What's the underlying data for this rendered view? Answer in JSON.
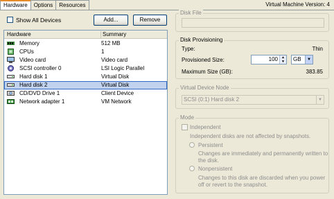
{
  "tabs": [
    {
      "label": "Hardware",
      "active": true
    },
    {
      "label": "Options",
      "active": false
    },
    {
      "label": "Resources",
      "active": false
    }
  ],
  "version": "Virtual Machine Version: 4",
  "show_all": {
    "label": "Show All Devices",
    "checked": false
  },
  "buttons": {
    "add": "Add...",
    "remove": "Remove"
  },
  "list": {
    "headers": {
      "hardware": "Hardware",
      "summary": "Summary"
    },
    "rows": [
      {
        "name": "Memory",
        "summary": "512 MB",
        "icon": "memory-icon"
      },
      {
        "name": "CPUs",
        "summary": "1",
        "icon": "cpu-icon"
      },
      {
        "name": "Video card",
        "summary": "Video card",
        "icon": "video-card-icon"
      },
      {
        "name": "SCSI controller 0",
        "summary": "LSI Logic Parallel",
        "icon": "scsi-controller-icon"
      },
      {
        "name": "Hard disk 1",
        "summary": "Virtual Disk",
        "icon": "hard-disk-icon"
      },
      {
        "name": "Hard disk 2",
        "summary": "Virtual Disk",
        "icon": "hard-disk-icon"
      },
      {
        "name": "CD/DVD Drive 1",
        "summary": "Client Device",
        "icon": "cd-dvd-icon"
      },
      {
        "name": "Network adapter 1",
        "summary": "VM Network",
        "icon": "network-adapter-icon"
      }
    ],
    "selected_index": 5
  },
  "disk_file": {
    "title": "Disk File",
    "value": ""
  },
  "provisioning": {
    "title": "Disk Provisioning",
    "type_label": "Type:",
    "type_value": "Thin",
    "size_label": "Provisioned Size:",
    "size_value": "100",
    "size_unit": "GB",
    "max_label": "Maximum Size (GB):",
    "max_value": "383.85"
  },
  "device_node": {
    "title": "Virtual Device Node",
    "value": "SCSI (0:1) Hard disk 2"
  },
  "mode": {
    "title": "Mode",
    "independent_label": "Independent",
    "independent_desc": "Independent disks are not affected by snapshots.",
    "persistent_label": "Persistent",
    "persistent_desc_1": "Changes are immediately and permanently written to",
    "persistent_desc_2": "the disk.",
    "nonpersistent_label": "Nonpersistent",
    "nonpersistent_desc_1": "Changes to this disk are discarded when you power",
    "nonpersistent_desc_2": "off or revert to the snapshot."
  }
}
